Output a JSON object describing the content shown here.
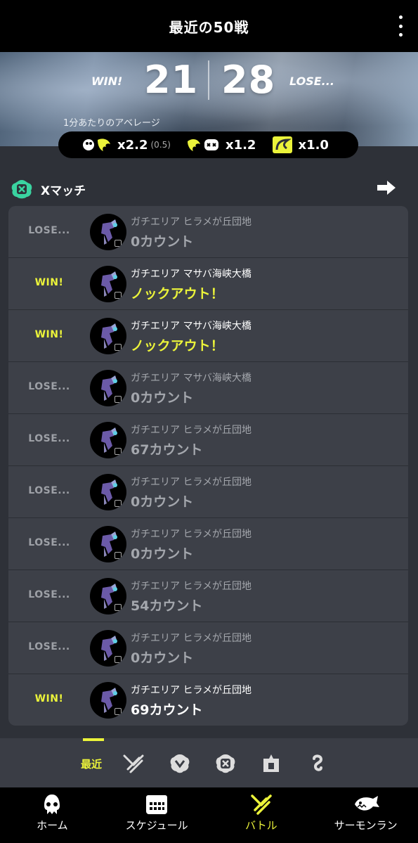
{
  "header": {
    "title": "最近の50戦"
  },
  "summary": {
    "win_label": "WIN!",
    "win_count": "21",
    "lose_count": "28",
    "lose_label": "LOSE...",
    "avg_label": "1分あたりのアベレージ",
    "kill_assist": "x2.2",
    "assist": "(0.5)",
    "death": "x1.2",
    "special": "x1.0"
  },
  "section": {
    "label": "Xマッチ"
  },
  "battles": [
    {
      "result": "LOSE...",
      "outcome": "lose",
      "stage": "ガチエリア ヒラメが丘団地",
      "count": "0カウント",
      "count_style": "lose",
      "stage_style": "dim"
    },
    {
      "result": "WIN!",
      "outcome": "win",
      "stage": "ガチエリア マサバ海峡大橋",
      "count": "ノックアウト！",
      "count_style": "win",
      "stage_style": "bright"
    },
    {
      "result": "WIN!",
      "outcome": "win",
      "stage": "ガチエリア マサバ海峡大橋",
      "count": "ノックアウト！",
      "count_style": "win",
      "stage_style": "bright"
    },
    {
      "result": "LOSE...",
      "outcome": "lose",
      "stage": "ガチエリア マサバ海峡大橋",
      "count": "0カウント",
      "count_style": "lose",
      "stage_style": "dim"
    },
    {
      "result": "LOSE...",
      "outcome": "lose",
      "stage": "ガチエリア ヒラメが丘団地",
      "count": "67カウント",
      "count_style": "lose",
      "stage_style": "dim"
    },
    {
      "result": "LOSE...",
      "outcome": "lose",
      "stage": "ガチエリア ヒラメが丘団地",
      "count": "0カウント",
      "count_style": "lose",
      "stage_style": "dim"
    },
    {
      "result": "LOSE...",
      "outcome": "lose",
      "stage": "ガチエリア ヒラメが丘団地",
      "count": "0カウント",
      "count_style": "lose",
      "stage_style": "dim"
    },
    {
      "result": "LOSE...",
      "outcome": "lose",
      "stage": "ガチエリア ヒラメが丘団地",
      "count": "54カウント",
      "count_style": "lose",
      "stage_style": "dim"
    },
    {
      "result": "LOSE...",
      "outcome": "lose",
      "stage": "ガチエリア ヒラメが丘団地",
      "count": "0カウント",
      "count_style": "lose",
      "stage_style": "dim"
    },
    {
      "result": "WIN!",
      "outcome": "win",
      "stage": "ガチエリア ヒラメが丘団地",
      "count": "69カウント",
      "count_style": "white",
      "stage_style": "bright"
    }
  ],
  "filters": {
    "recent_label": "最近",
    "icons": [
      "regular-battle-icon",
      "bankara-battle-icon",
      "x-battle-icon",
      "league-battle-icon",
      "private-battle-icon"
    ]
  },
  "nav": [
    {
      "label": "ホーム",
      "icon": "squid-home-icon"
    },
    {
      "label": "スケジュール",
      "icon": "calendar-icon"
    },
    {
      "label": "バトル",
      "icon": "battle-icon",
      "active": true
    },
    {
      "label": "サーモンラン",
      "icon": "salmon-icon"
    }
  ],
  "colors": {
    "accent": "#ebf33a",
    "win": "#ebf33a",
    "lose": "#9da0a6",
    "row_bg": "#3d4048"
  }
}
